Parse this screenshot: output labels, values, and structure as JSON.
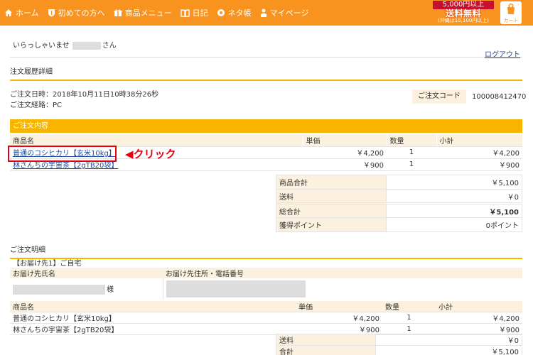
{
  "nav": {
    "items": [
      {
        "label": "ホーム",
        "icon": "home-icon"
      },
      {
        "label": "初めての方へ",
        "icon": "shield-icon"
      },
      {
        "label": "商品メニュー",
        "icon": "gift-icon"
      },
      {
        "label": "日記",
        "icon": "book-icon"
      },
      {
        "label": "ネタ帳",
        "icon": "gear-icon"
      },
      {
        "label": "マイページ",
        "icon": "person-icon"
      }
    ],
    "banner_line1": "5,000円以上",
    "banner_line2": "送料無料",
    "banner_line3": "(沖縄は10,100円以上)",
    "cart_label": "カート"
  },
  "greeting": {
    "prefix": "いらっしゃいませ",
    "suffix": "さん"
  },
  "logout": "ログアウト",
  "section_title": "注文履歴詳細",
  "order_meta": {
    "date": "ご注文日時：2018年10月11日10時38分26秒",
    "route": "ご注文経路：PC",
    "code_label": "ご注文コード",
    "code_value": "100008412470"
  },
  "order_contents": {
    "title": "ご注文内容",
    "headers": [
      "商品名",
      "単価",
      "数量",
      "小計"
    ],
    "rows": [
      {
        "name": "普通のコシヒカリ【玄米10kg】",
        "price": "￥4,200",
        "qty": "1",
        "subtotal": "￥4,200"
      },
      {
        "name": "林さんちの宇宙茶【2gTB20袋】",
        "price": "￥900",
        "qty": "1",
        "subtotal": "￥900"
      }
    ],
    "annotation": "◀クリック"
  },
  "totals": {
    "product_total_label": "商品合計",
    "product_total": "￥5,100",
    "shipping_label": "送料",
    "shipping": "￥0",
    "grand_total_label": "総合計",
    "grand_total": "￥5,100",
    "points_label": "獲得ポイント",
    "points": "0ポイント"
  },
  "details": {
    "title": "ご注文明細",
    "destination": "【お届け先1】ご自宅",
    "recipient_label": "お届け先氏名",
    "address_label": "お届け先住所・電話番号",
    "honorific": "様",
    "headers": [
      "商品名",
      "単価",
      "数量",
      "小計"
    ],
    "rows": [
      {
        "name": "普通のコシヒカリ【玄米10kg】",
        "price": "￥4,200",
        "qty": "1",
        "subtotal": "￥4,200"
      },
      {
        "name": "林さんちの宇宙茶【2gTB20袋】",
        "price": "￥900",
        "qty": "1",
        "subtotal": "￥900"
      }
    ],
    "shipping_label": "送料",
    "shipping": "￥0",
    "total_label": "合計",
    "total": "￥5,100"
  },
  "colors": {
    "accent": "#f7931e",
    "section": "#f7b500",
    "highlight": "#e60012",
    "link": "#1a4a9f"
  }
}
